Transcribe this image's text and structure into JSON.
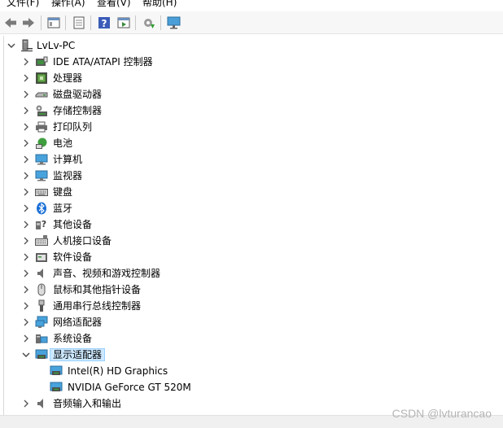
{
  "menubar": {
    "items": [
      {
        "label": "文件(F)"
      },
      {
        "label": "操作(A)"
      },
      {
        "label": "查看(V)"
      },
      {
        "label": "帮助(H)"
      }
    ]
  },
  "toolbar": {
    "buttons": [
      {
        "icon": "back-arrow-icon"
      },
      {
        "icon": "forward-arrow-icon"
      },
      {
        "icon": "console-tree-icon"
      },
      {
        "icon": "properties-icon"
      },
      {
        "icon": "help-icon"
      },
      {
        "icon": "action-pane-icon"
      },
      {
        "icon": "update-driver-icon"
      },
      {
        "icon": "monitor-scan-icon"
      }
    ]
  },
  "tree": {
    "root": {
      "label": "LvLv-PC",
      "icon": "computer-tower-icon",
      "expanded": true
    },
    "categories": [
      {
        "label": "IDE ATA/ATAPI 控制器",
        "icon": "ide-controller-icon",
        "expanded": false
      },
      {
        "label": "处理器",
        "icon": "processor-icon",
        "expanded": false
      },
      {
        "label": "磁盘驱动器",
        "icon": "disk-drive-icon",
        "expanded": false
      },
      {
        "label": "存储控制器",
        "icon": "storage-controller-icon",
        "expanded": false
      },
      {
        "label": "打印队列",
        "icon": "printer-icon",
        "expanded": false
      },
      {
        "label": "电池",
        "icon": "battery-icon",
        "expanded": false
      },
      {
        "label": "计算机",
        "icon": "computer-monitor-icon",
        "expanded": false
      },
      {
        "label": "监视器",
        "icon": "monitor-icon",
        "expanded": false
      },
      {
        "label": "键盘",
        "icon": "keyboard-icon",
        "expanded": false
      },
      {
        "label": "蓝牙",
        "icon": "bluetooth-icon",
        "expanded": false
      },
      {
        "label": "其他设备",
        "icon": "other-devices-icon",
        "expanded": false
      },
      {
        "label": "人机接口设备",
        "icon": "hid-icon",
        "expanded": false
      },
      {
        "label": "软件设备",
        "icon": "software-device-icon",
        "expanded": false
      },
      {
        "label": "声音、视频和游戏控制器",
        "icon": "speaker-icon",
        "expanded": false
      },
      {
        "label": "鼠标和其他指针设备",
        "icon": "mouse-icon",
        "expanded": false
      },
      {
        "label": "通用串行总线控制器",
        "icon": "usb-icon",
        "expanded": false
      },
      {
        "label": "网络适配器",
        "icon": "network-adapter-icon",
        "expanded": false
      },
      {
        "label": "系统设备",
        "icon": "system-device-icon",
        "expanded": false
      },
      {
        "label": "显示适配器",
        "icon": "display-adapter-icon",
        "expanded": true,
        "selected": true,
        "children": [
          {
            "label": "Intel(R) HD Graphics",
            "icon": "display-adapter-icon"
          },
          {
            "label": "NVIDIA GeForce GT 520M",
            "icon": "display-adapter-icon"
          }
        ]
      },
      {
        "label": "音频输入和输出",
        "icon": "audio-io-icon",
        "expanded": false
      }
    ]
  },
  "watermark": {
    "text": "CSDN @lvturancao"
  },
  "colors": {
    "selection": "#cce8ff",
    "selection_border": "#99d1ff"
  }
}
